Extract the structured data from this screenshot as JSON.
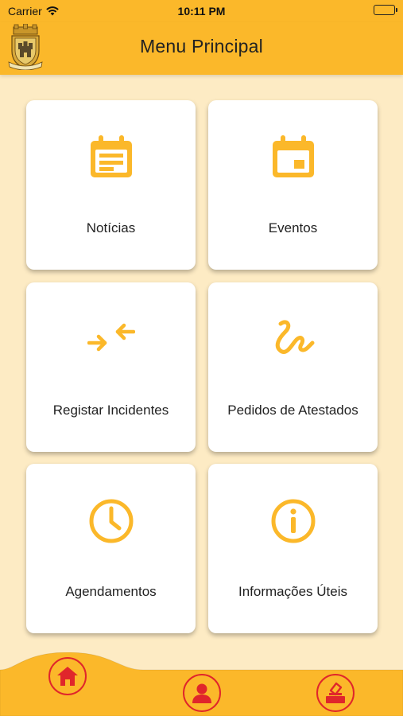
{
  "status_bar": {
    "carrier": "Carrier",
    "time": "10:11 PM"
  },
  "header": {
    "title": "Menu Principal",
    "logo": "coat-of-arms"
  },
  "menu": {
    "items": [
      {
        "label": "Notícias",
        "icon": "news-icon"
      },
      {
        "label": "Eventos",
        "icon": "calendar-event-icon"
      },
      {
        "label": "Registar Incidentes",
        "icon": "arrows-swap-icon"
      },
      {
        "label": "Pedidos de Atestados",
        "icon": "signature-icon"
      },
      {
        "label": "Agendamentos",
        "icon": "clock-icon"
      },
      {
        "label": "Informações Úteis",
        "icon": "info-icon"
      }
    ]
  },
  "bottom_nav": {
    "items": [
      {
        "icon": "home-icon",
        "active": true
      },
      {
        "icon": "user-icon",
        "active": false
      },
      {
        "icon": "vote-icon",
        "active": false
      }
    ]
  },
  "colors": {
    "primary": "#FBB82A",
    "background": "#FDEBC4",
    "accent": "#E0262B"
  }
}
